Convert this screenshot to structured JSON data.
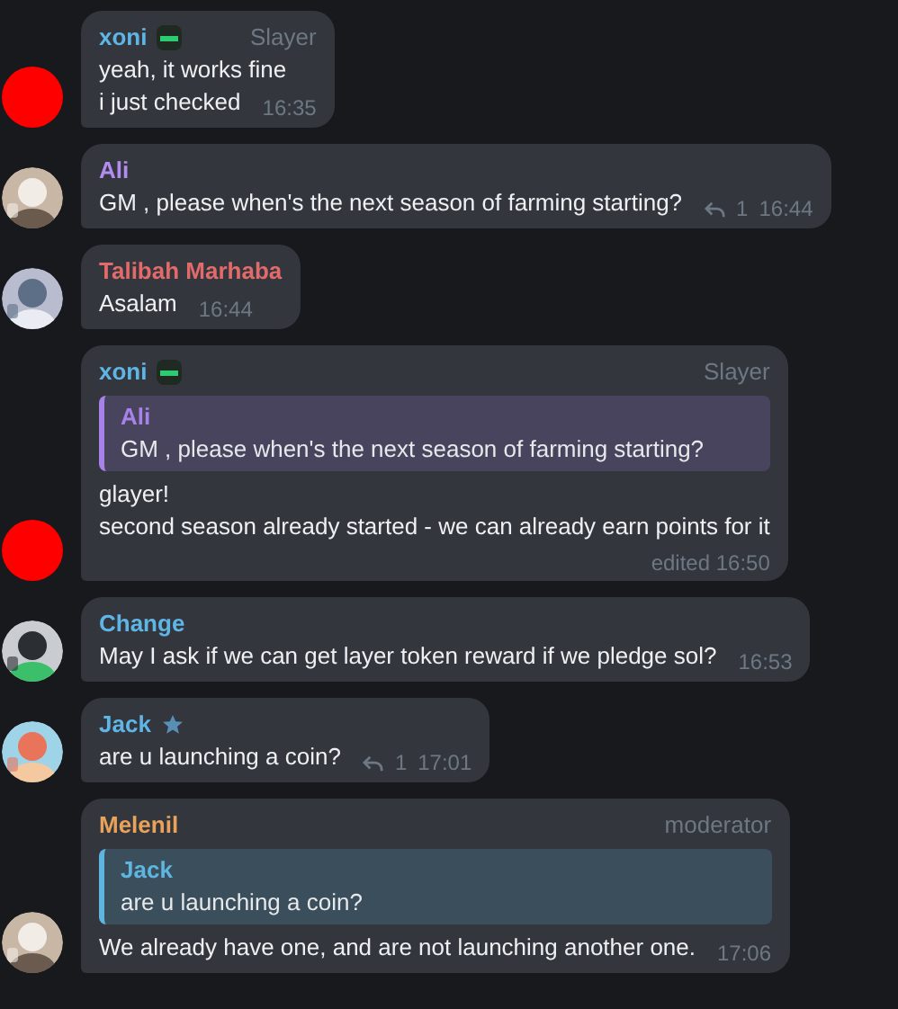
{
  "messages": [
    {
      "author": "xoni",
      "color": "#5fb6e6",
      "author_badge": true,
      "rank": "Slayer",
      "avatar": {
        "kind": "color",
        "color": "#ff0000"
      },
      "lines": [
        "yeah, it works fine",
        "i just checked"
      ],
      "time": "16:35"
    },
    {
      "author": "Ali",
      "color": "#b38cf0",
      "avatar": {
        "kind": "picture"
      },
      "lines": [
        "GM , please when's the next season of farming starting?"
      ],
      "replies": "1",
      "time": "16:44"
    },
    {
      "author": "Talibah Marhaba",
      "color": "#e36a6a",
      "avatar": {
        "kind": "picture"
      },
      "lines": [
        "Asalam"
      ],
      "time": "16:44"
    },
    {
      "author": "xoni",
      "color": "#5fb6e6",
      "author_badge": true,
      "rank": "Slayer",
      "avatar": {
        "kind": "color",
        "color": "#ff0000"
      },
      "quote": {
        "author": "Ali",
        "text": "GM , please when's the next season of farming starting?",
        "color": "#a782e8"
      },
      "lines": [
        "glayer!",
        "second season already started - we can already earn points for it"
      ],
      "time": "edited 16:50",
      "meta_below": true
    },
    {
      "author": "Change",
      "color": "#5fb6e6",
      "avatar": {
        "kind": "picture"
      },
      "lines": [
        "May I ask if we can get layer token reward if we pledge sol?"
      ],
      "time": "16:53"
    },
    {
      "author": "Jack",
      "color": "#5fb6e6",
      "star": true,
      "avatar": {
        "kind": "picture"
      },
      "lines": [
        "are u launching a coin?"
      ],
      "replies": "1",
      "time": "17:01"
    },
    {
      "author": "Melenil",
      "color": "#e8a25a",
      "rank": "moderator",
      "avatar": {
        "kind": "picture"
      },
      "quote": {
        "author": "Jack",
        "text": "are u launching a coin?",
        "color": "#5eb5e0"
      },
      "lines": [
        "We already have one, and are not launching another one."
      ],
      "time": "17:06"
    }
  ]
}
